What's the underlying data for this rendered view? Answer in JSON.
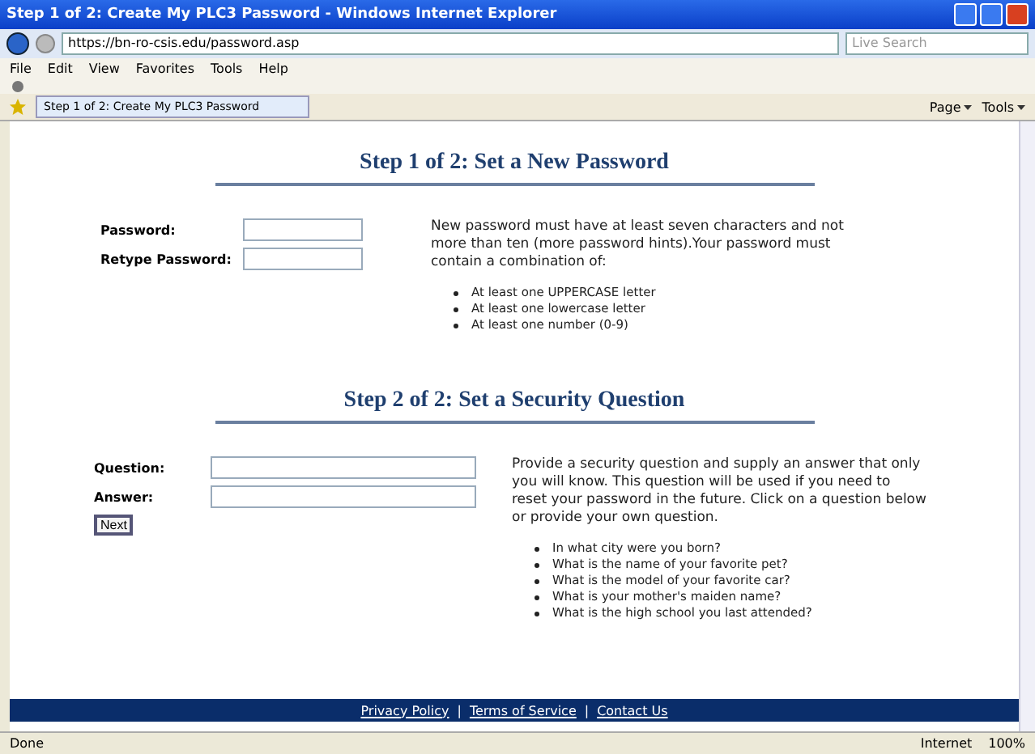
{
  "window": {
    "title": "Step 1 of 2: Create My PLC3 Password - Windows Internet Explorer"
  },
  "address_bar": {
    "url": "https://bn-ro-csis.edu/password.asp",
    "search_placeholder": "Live Search"
  },
  "menu": [
    "File",
    "Edit",
    "View",
    "Favorites",
    "Tools",
    "Help"
  ],
  "tab": {
    "title": "Step 1 of 2: Create My PLC3 Password"
  },
  "command_bar": [
    "Page",
    "Tools"
  ],
  "step1": {
    "heading": "Step 1 of 2: Set a New Password",
    "fields": [
      {
        "label": "Password:"
      },
      {
        "label": "Retype Password:"
      }
    ],
    "info": "New password must have at least seven characters and not more than ten (more password hints).Your password must contain a combination of:",
    "rules": [
      "At least one UPPERCASE letter",
      "At least one lowercase letter",
      "At least one number (0-9)"
    ]
  },
  "step2": {
    "heading": "Step 2 of 2: Set a Security Question",
    "fields": [
      {
        "label": "Question:"
      },
      {
        "label": "Answer:"
      }
    ],
    "button": "Next",
    "info": "Provide a security question and supply an answer that only you will know. This question will be used if you need to reset your password in the future. Click on a question below or provide your own question.",
    "questions": [
      "In what city were you born?",
      "What is the name of your favorite pet?",
      "What is the model of your favorite car?",
      "What is your mother's maiden name?",
      "What is the high school you last attended?"
    ]
  },
  "footer": {
    "links": [
      "Privacy Policy",
      "Terms of Service",
      "Contact Us"
    ],
    "separator": "|"
  },
  "status_bar": {
    "status": "Done",
    "zone": "Internet",
    "zoom": "100%"
  }
}
